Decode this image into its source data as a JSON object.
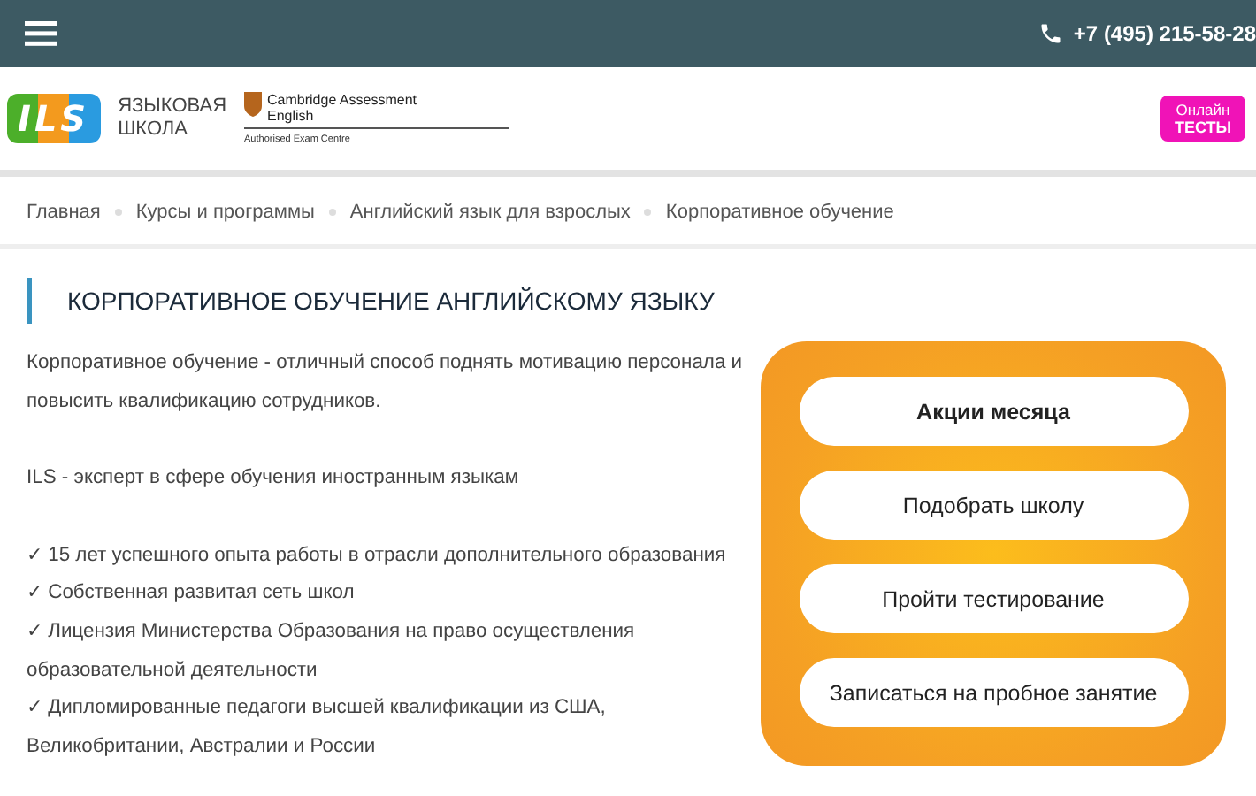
{
  "top_bar": {
    "phone": "+7 (495) 215-58-28"
  },
  "header": {
    "logo_text": "ILS",
    "school_label": [
      "ЯЗЫКОВАЯ",
      "ШКОЛА"
    ],
    "cambridge": {
      "title": "Cambridge Assessment",
      "subtitle": "English",
      "note": "Authorised Exam Centre"
    },
    "online_tests": [
      "Онлайн",
      "ТЕСТЫ"
    ]
  },
  "breadcrumbs": [
    "Главная",
    "Курсы и программы",
    "Английский язык для взрослых",
    "Корпоративное обучение"
  ],
  "title": "КОРПОРАТИВНОЕ ОБУЧЕНИЕ АНГЛИЙСКОМУ ЯЗЫКУ",
  "intro": "Корпоративное обучение - отличный способ поднять мотивацию персонала и повысить квалификацию сотрудников.",
  "subtitle": "ILS - эксперт в сфере обучения иностранным языкам",
  "benefits": [
    "✓ 15 лет успешного опыта работы в отрасли дополнительного образования",
    "✓ Собственная развитая сеть школ",
    "✓ Лицензия Министерства Образования на право осуществления образовательной деятельности",
    "✓ Дипломированные педагоги высшей квалификации из США, Великобритании, Австралии и России"
  ],
  "actions": [
    {
      "label": "Акции месяца",
      "emphasized": true
    },
    {
      "label": "Подобрать школу",
      "emphasized": false
    },
    {
      "label": "Пройти тестирование",
      "emphasized": false
    },
    {
      "label": "Записаться на пробное занятие",
      "emphasized": false
    }
  ]
}
